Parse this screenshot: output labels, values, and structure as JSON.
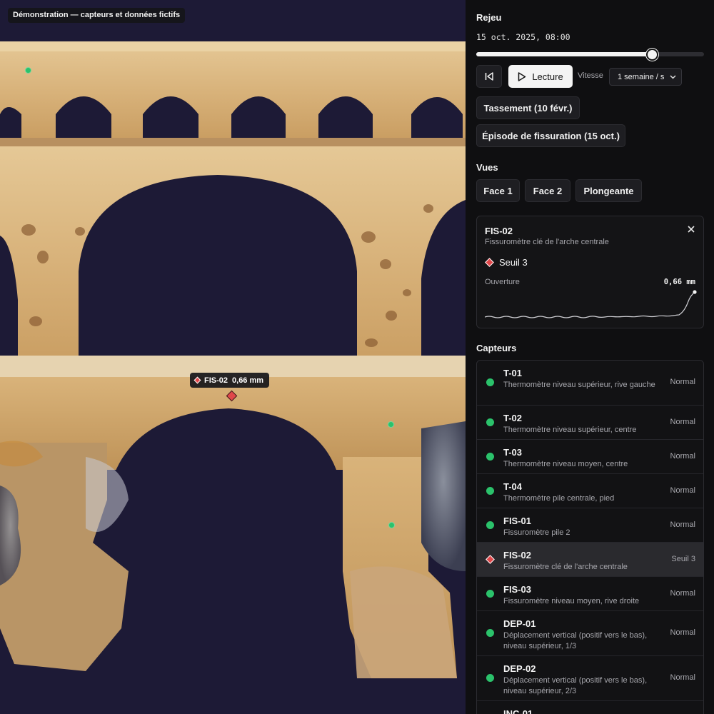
{
  "viewport": {
    "demo_badge": "Démonstration — capteurs et données fictifs",
    "tag": {
      "name": "FIS-02",
      "value": "0,66 mm"
    }
  },
  "replay": {
    "title": "Rejeu",
    "timestamp": "15 oct. 2025, 08:00",
    "progress": 0.77,
    "play_label": "Lecture",
    "speed_label": "Vitesse",
    "speed_value": "1 semaine / s",
    "events": [
      "Tassement (10 févr.)",
      "Épisode de fissuration (15 oct.)"
    ]
  },
  "views": {
    "title": "Vues",
    "items": [
      "Face 1",
      "Face 2",
      "Plongeante"
    ]
  },
  "detail": {
    "name": "FIS-02",
    "description": "Fissuromètre clé de l'arche centrale",
    "state": "Seuil 3",
    "metric_label": "Ouverture",
    "metric_value": "0,66 mm"
  },
  "sensors": {
    "title": "Capteurs",
    "items": [
      {
        "name": "T-01",
        "description": "Thermomètre niveau supérieur, rive gauche",
        "status": "Normal",
        "level": "normal"
      },
      {
        "name": "T-02",
        "description": "Thermomètre niveau supérieur, centre",
        "status": "Normal",
        "level": "normal"
      },
      {
        "name": "T-03",
        "description": "Thermomètre niveau moyen, centre",
        "status": "Normal",
        "level": "normal"
      },
      {
        "name": "T-04",
        "description": "Thermomètre pile centrale, pied",
        "status": "Normal",
        "level": "normal"
      },
      {
        "name": "FIS-01",
        "description": "Fissuromètre pile 2",
        "status": "Normal",
        "level": "normal"
      },
      {
        "name": "FIS-02",
        "description": "Fissuromètre clé de l'arche centrale",
        "status": "Seuil 3",
        "level": "alert"
      },
      {
        "name": "FIS-03",
        "description": "Fissuromètre niveau moyen, rive droite",
        "status": "Normal",
        "level": "normal"
      },
      {
        "name": "DEP-01",
        "description": "Déplacement vertical (positif vers le bas), niveau supérieur, 1/3",
        "status": "Normal",
        "level": "normal"
      },
      {
        "name": "DEP-02",
        "description": "Déplacement vertical (positif vers le bas), niveau supérieur, 2/3",
        "status": "Normal",
        "level": "normal"
      },
      {
        "name": "INC-01",
        "description": "",
        "status": "",
        "level": "normal"
      }
    ]
  },
  "colors": {
    "normal": "#2bc26b",
    "alert": "#e0474a",
    "panel": "#0f0f11",
    "sky": "#1d1a36",
    "stone": "#d9b77f"
  }
}
